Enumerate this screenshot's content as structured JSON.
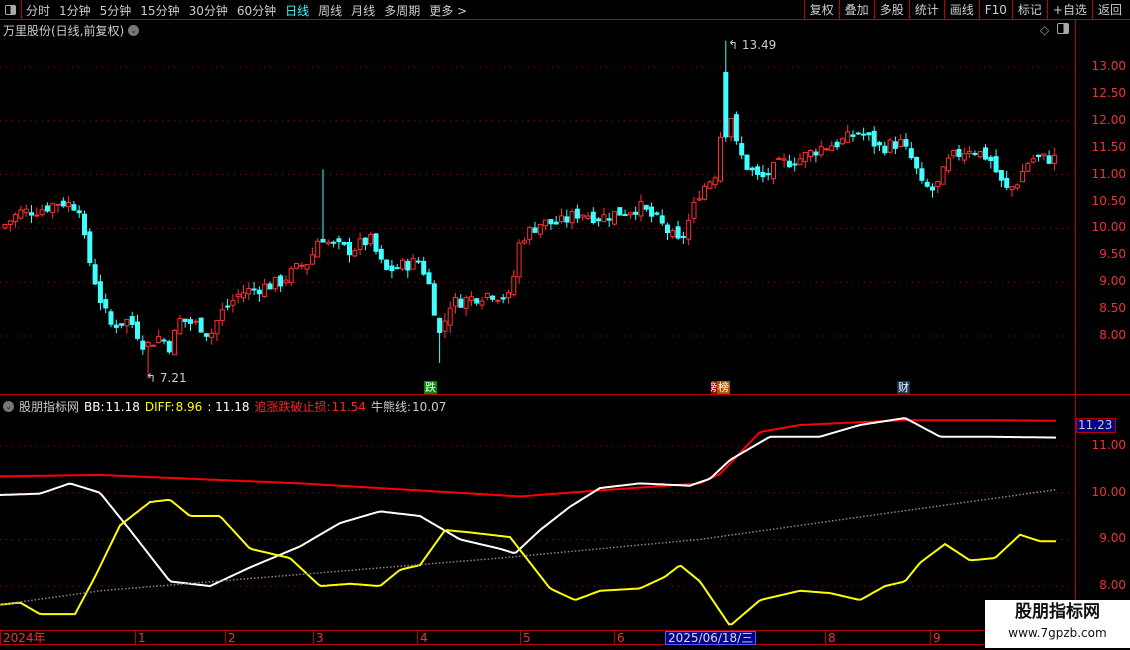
{
  "toolbar": {
    "periods": [
      "分时",
      "1分钟",
      "5分钟",
      "15分钟",
      "30分钟",
      "60分钟",
      "日线",
      "周线",
      "月线",
      "多周期",
      "更多 >"
    ],
    "active": "日线",
    "right_buttons": [
      "复权",
      "叠加",
      "多股",
      "统计",
      "画线",
      "F10",
      "标记",
      "+自选",
      "返回"
    ]
  },
  "stock_title": "万里股份(日线,前复权)",
  "price_axis": [
    "13.00",
    "12.50",
    "12.00",
    "11.50",
    "11.00",
    "10.50",
    "10.00",
    "9.50",
    "9.00",
    "8.50",
    "8.00"
  ],
  "annotations": {
    "high": "13.49",
    "low": "7.21"
  },
  "event_tags": [
    {
      "label": "跌",
      "color": "#080"
    },
    {
      "label": "龙虎榜",
      "display": "榜",
      "color": "#a50"
    },
    {
      "label": "财",
      "color": "#135"
    }
  ],
  "indicator": {
    "name": "股朋指标网",
    "bb_label": "BB:",
    "bb": "11.18",
    "diff_label": "DIFF:",
    "diff": "8.96",
    "unnamed": ": 11.18",
    "stop_label": "追涨跌破止损:",
    "stop": "11.54",
    "bull_label": "牛熊线:",
    "bull": "10.07",
    "current_value": "11.23",
    "axis": [
      "11.00",
      "10.00",
      "9.00",
      "8.00"
    ]
  },
  "xaxis": {
    "labels": [
      "2024年",
      "1",
      "2",
      "3",
      "4",
      "5",
      "6",
      "8",
      "9"
    ],
    "cursor_date": "2025/06/18/三"
  },
  "watermark": {
    "title": "股朋指标网",
    "url": "www.7gpzb.com"
  },
  "colors": {
    "up": "#ff3030",
    "down": "#40ffff",
    "border": "#bb0000",
    "bb": "#ffffff",
    "diff": "#ffff00",
    "stop": "#ff0000",
    "bull": "#888888"
  },
  "chart_data": {
    "type": "line",
    "price_close": [
      [
        0,
        10.0
      ],
      [
        20,
        10.3
      ],
      [
        40,
        10.35
      ],
      [
        60,
        10.5
      ],
      [
        80,
        10.4
      ],
      [
        85,
        9.7
      ],
      [
        100,
        8.7
      ],
      [
        110,
        8.2
      ],
      [
        130,
        8.3
      ],
      [
        145,
        7.8
      ],
      [
        160,
        8.0
      ],
      [
        170,
        7.8
      ],
      [
        180,
        8.3
      ],
      [
        200,
        8.2
      ],
      [
        210,
        8.0
      ],
      [
        220,
        8.4
      ],
      [
        240,
        8.8
      ],
      [
        260,
        8.9
      ],
      [
        280,
        9.0
      ],
      [
        300,
        9.3
      ],
      [
        310,
        9.4
      ],
      [
        320,
        9.9
      ],
      [
        330,
        9.7
      ],
      [
        350,
        9.6
      ],
      [
        370,
        9.8
      ],
      [
        385,
        9.2
      ],
      [
        400,
        9.3
      ],
      [
        420,
        9.4
      ],
      [
        430,
        8.9
      ],
      [
        440,
        8.0
      ],
      [
        450,
        8.6
      ],
      [
        470,
        8.7
      ],
      [
        490,
        8.8
      ],
      [
        510,
        8.7
      ],
      [
        520,
        9.8
      ],
      [
        540,
        10.1
      ],
      [
        560,
        10.1
      ],
      [
        580,
        10.3
      ],
      [
        600,
        10.2
      ],
      [
        620,
        10.3
      ],
      [
        640,
        10.4
      ],
      [
        660,
        10.1
      ],
      [
        680,
        9.7
      ],
      [
        690,
        10.2
      ],
      [
        700,
        10.7
      ],
      [
        715,
        11.0
      ],
      [
        727,
        12.6
      ],
      [
        735,
        11.6
      ],
      [
        745,
        11.2
      ],
      [
        760,
        10.9
      ],
      [
        780,
        11.2
      ],
      [
        800,
        11.3
      ],
      [
        820,
        11.5
      ],
      [
        840,
        11.6
      ],
      [
        860,
        11.8
      ],
      [
        880,
        11.5
      ],
      [
        900,
        11.6
      ],
      [
        915,
        11.2
      ],
      [
        920,
        10.8
      ],
      [
        935,
        10.7
      ],
      [
        950,
        11.3
      ],
      [
        970,
        11.5
      ],
      [
        990,
        11.3
      ],
      [
        1005,
        10.7
      ],
      [
        1015,
        10.8
      ],
      [
        1030,
        11.3
      ],
      [
        1058,
        11.3
      ]
    ],
    "series": [
      {
        "name": "追涨跌破止损",
        "pts": [
          [
            0,
            10.35
          ],
          [
            100,
            10.38
          ],
          [
            300,
            10.2
          ],
          [
            520,
            9.92
          ],
          [
            600,
            10.05
          ],
          [
            700,
            10.2
          ],
          [
            720,
            10.4
          ],
          [
            760,
            11.3
          ],
          [
            800,
            11.45
          ],
          [
            900,
            11.55
          ],
          [
            1000,
            11.55
          ],
          [
            1058,
            11.54
          ]
        ]
      },
      {
        "name": "BB",
        "pts": [
          [
            0,
            9.95
          ],
          [
            40,
            9.98
          ],
          [
            70,
            10.2
          ],
          [
            100,
            10.0
          ],
          [
            130,
            9.2
          ],
          [
            170,
            8.1
          ],
          [
            210,
            8.0
          ],
          [
            250,
            8.4
          ],
          [
            300,
            8.85
          ],
          [
            340,
            9.35
          ],
          [
            380,
            9.6
          ],
          [
            420,
            9.5
          ],
          [
            460,
            9.0
          ],
          [
            500,
            8.8
          ],
          [
            515,
            8.7
          ],
          [
            540,
            9.2
          ],
          [
            570,
            9.7
          ],
          [
            600,
            10.1
          ],
          [
            640,
            10.2
          ],
          [
            690,
            10.15
          ],
          [
            710,
            10.3
          ],
          [
            730,
            10.7
          ],
          [
            770,
            11.2
          ],
          [
            820,
            11.2
          ],
          [
            860,
            11.45
          ],
          [
            905,
            11.6
          ],
          [
            940,
            11.2
          ],
          [
            980,
            11.2
          ],
          [
            1058,
            11.18
          ]
        ]
      },
      {
        "name": "DIFF",
        "pts": [
          [
            0,
            7.6
          ],
          [
            20,
            7.65
          ],
          [
            40,
            7.4
          ],
          [
            75,
            7.4
          ],
          [
            95,
            8.2
          ],
          [
            120,
            9.3
          ],
          [
            150,
            9.8
          ],
          [
            170,
            9.85
          ],
          [
            190,
            9.5
          ],
          [
            220,
            9.5
          ],
          [
            250,
            8.8
          ],
          [
            290,
            8.6
          ],
          [
            320,
            8.0
          ],
          [
            350,
            8.05
          ],
          [
            380,
            8.0
          ],
          [
            400,
            8.35
          ],
          [
            420,
            8.45
          ],
          [
            445,
            9.2
          ],
          [
            470,
            9.15
          ],
          [
            510,
            9.05
          ],
          [
            530,
            8.5
          ],
          [
            550,
            7.95
          ],
          [
            575,
            7.7
          ],
          [
            600,
            7.9
          ],
          [
            640,
            7.95
          ],
          [
            665,
            8.2
          ],
          [
            680,
            8.45
          ],
          [
            700,
            8.1
          ],
          [
            730,
            7.15
          ],
          [
            760,
            7.7
          ],
          [
            800,
            7.9
          ],
          [
            830,
            7.85
          ],
          [
            860,
            7.7
          ],
          [
            885,
            8.0
          ],
          [
            905,
            8.1
          ],
          [
            920,
            8.5
          ],
          [
            945,
            8.9
          ],
          [
            970,
            8.55
          ],
          [
            995,
            8.6
          ],
          [
            1020,
            9.1
          ],
          [
            1040,
            8.96
          ],
          [
            1058,
            8.96
          ]
        ]
      },
      {
        "name": "牛熊线",
        "pts": [
          [
            0,
            7.6
          ],
          [
            100,
            7.9
          ],
          [
            300,
            8.25
          ],
          [
            500,
            8.6
          ],
          [
            700,
            9.0
          ],
          [
            900,
            9.6
          ],
          [
            1058,
            10.07
          ]
        ]
      }
    ]
  }
}
